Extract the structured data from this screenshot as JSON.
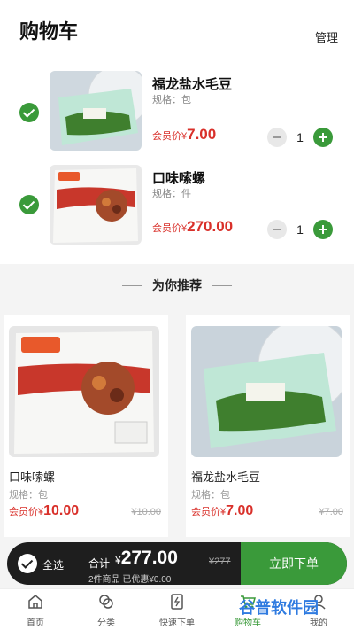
{
  "header": {
    "title": "购物车",
    "manage": "管理"
  },
  "cart": {
    "items": [
      {
        "name": "福龙盐水毛豆",
        "spec": "规格：包",
        "price_label": "会员价¥",
        "price": "7.00",
        "qty": "1",
        "checked": true
      },
      {
        "name": "口味嗦螺",
        "spec": "规格：件",
        "price_label": "会员价¥",
        "price": "270.00",
        "qty": "1",
        "checked": true
      }
    ]
  },
  "recommend": {
    "title": "为你推荐",
    "items": [
      {
        "name": "口味嗦螺",
        "spec": "规格：包",
        "price_label": "会员价¥",
        "price": "10.00",
        "old_price": "¥10.00"
      },
      {
        "name": "福龙盐水毛豆",
        "spec": "规格：包",
        "price_label": "会员价¥",
        "price": "7.00",
        "old_price": "¥7.00"
      }
    ]
  },
  "checkout": {
    "select_all": "全选",
    "total_label": "合计",
    "currency": "¥",
    "total": "277.00",
    "old_total": "¥277",
    "summary": "2件商品 已优惠¥0.00",
    "submit": "立即下单"
  },
  "tabbar": {
    "items": [
      {
        "label": "首页",
        "icon": "home-icon"
      },
      {
        "label": "分类",
        "icon": "category-icon"
      },
      {
        "label": "快速下单",
        "icon": "quick-order-icon"
      },
      {
        "label": "购物车",
        "icon": "cart-icon"
      },
      {
        "label": "我的",
        "icon": "profile-icon"
      }
    ]
  },
  "watermark": "谷普软件园",
  "colors": {
    "accent": "#3a9a3a",
    "price": "#d9302a",
    "bar": "#1e1e1e"
  }
}
